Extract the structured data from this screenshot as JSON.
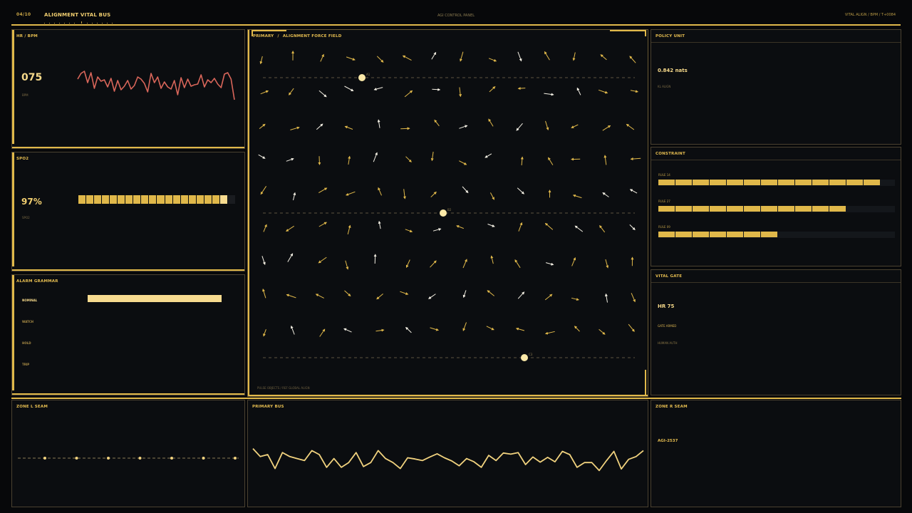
{
  "header": {
    "page_counter": "04/10",
    "title": "ALIGNMENT VITAL BUS",
    "center_label": "AGI CONTROL PANEL",
    "right_label": "VITAL ALIGN  /  BPM  /  T+0084"
  },
  "hr_panel": {
    "title": "HR / BPM",
    "value": "075",
    "unit": "BPM",
    "series": [
      63,
      71,
      74,
      58,
      72,
      50,
      66,
      60,
      62,
      52,
      64,
      46,
      61,
      48,
      53,
      61,
      49,
      54,
      66,
      63,
      57,
      45,
      71,
      58,
      66,
      50,
      59,
      52,
      49,
      61,
      41,
      65,
      51,
      63,
      53,
      55,
      56,
      69,
      52,
      62,
      58,
      64,
      56,
      51,
      70,
      72,
      63,
      34
    ]
  },
  "spo2_panel": {
    "title": "SPO2",
    "value": "97%",
    "label": "SPO2",
    "segments_total": 20,
    "segments_filled": 19
  },
  "alarm_panel": {
    "title": "ALARM GRAMMAR",
    "levels": [
      {
        "label": "NOMINAL",
        "active": true
      },
      {
        "label": "WATCH",
        "active": false
      },
      {
        "label": "HOLD",
        "active": false
      },
      {
        "label": "TRIP",
        "active": false
      }
    ]
  },
  "field_panel": {
    "title_left": "PRIMARY",
    "title_sep": "/",
    "title_right": "ALIGNMENT FORCE FIELD",
    "footer": "PULSE OBJECTS  /  REF GLOBAL ALIGN",
    "markers": [
      {
        "label": "A1"
      },
      {
        "label": "B2"
      },
      {
        "label": "C3"
      }
    ]
  },
  "policy_panel": {
    "title": "POLICY UNIT",
    "value": "0.842 nats",
    "sub": "KL ALIGN"
  },
  "constraint_panel": {
    "title": "CONSTRAINT",
    "rules": [
      {
        "label": "RULE 14",
        "fill": 0.93,
        "segments": 13
      },
      {
        "label": "RULE 27",
        "fill": 0.79,
        "segments": 11
      },
      {
        "label": "RULE 09",
        "fill": 0.5,
        "segments": 7
      }
    ]
  },
  "gate_panel": {
    "title": "VITAL GATE",
    "value": "HR 75",
    "status": "GATE ARMED",
    "sub": "HUMAN AUTH"
  },
  "zone_l": {
    "title": "ZONE L SEAM",
    "nodes": 7
  },
  "primary_bus": {
    "title": "PRIMARY BUS",
    "series": [
      35,
      55,
      50,
      85,
      45,
      55,
      60,
      65,
      40,
      50,
      82,
      60,
      82,
      70,
      45,
      80,
      70,
      40,
      60,
      70,
      85,
      58,
      61,
      65,
      56,
      48,
      58,
      66,
      78,
      60,
      68,
      82,
      52,
      65,
      46,
      49,
      45,
      75,
      56,
      69,
      57,
      68,
      42,
      50,
      82,
      70,
      70,
      90,
      65,
      42,
      86,
      62,
      55,
      40
    ]
  },
  "zone_r": {
    "title": "ZONE R SEAM",
    "value": "AGI-2537"
  },
  "colors": {
    "accent": "#e0b84a",
    "bright": "#f6d98a",
    "hr_line": "#d9665a",
    "wave": "#f1d27e",
    "panel_bg": "#0b0d10",
    "border": "#4a4130"
  }
}
